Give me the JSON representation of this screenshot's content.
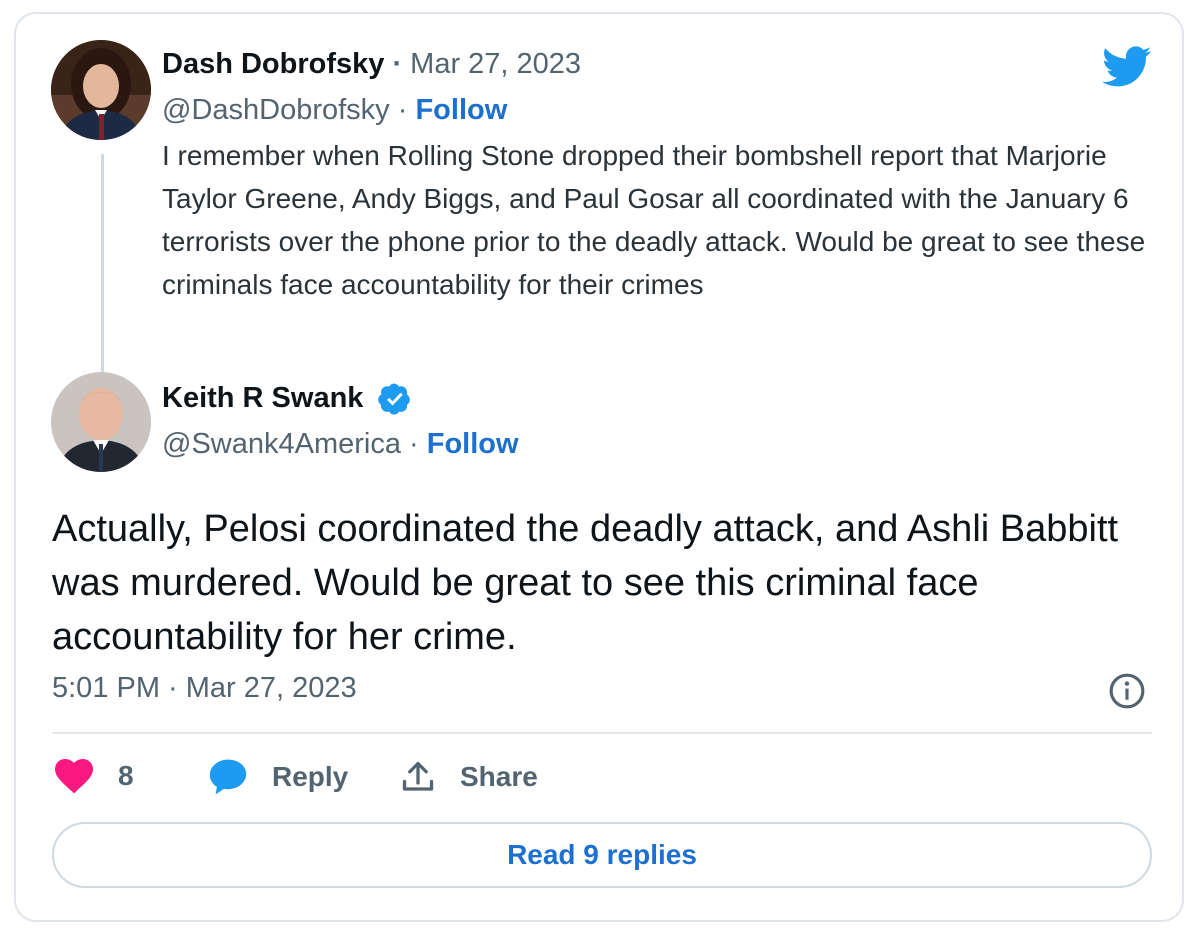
{
  "quoted_tweet": {
    "author_name": "Dash Dobrofsky",
    "date": "Mar 27, 2023",
    "handle": "@DashDobrofsky",
    "follow_label": "Follow",
    "text": "I remember when Rolling Stone dropped their bombshell report that Marjorie Taylor Greene, Andy Biggs, and Paul Gosar all coordinated with the January 6 terrorists over the phone prior to the deadly attack. Would be great to see these criminals face accountability for their crimes"
  },
  "main_tweet": {
    "author_name": "Keith R Swank",
    "verified": true,
    "handle": "@Swank4America",
    "follow_label": "Follow",
    "text": "Actually, Pelosi coordinated the deadly attack, and Ashli Babbitt was murdered. Would be great to see this criminal face accountability for her crime.",
    "timestamp": "5:01 PM · Mar 27, 2023"
  },
  "actions": {
    "like_count": "8",
    "reply_label": "Reply",
    "share_label": "Share"
  },
  "read_replies_label": "Read 9 replies",
  "separator": " · ",
  "icons": {
    "logo": "twitter-bird-icon",
    "info": "info-icon",
    "like": "heart-icon",
    "reply": "speech-bubble-icon",
    "share": "share-upload-icon",
    "verified": "verified-badge-icon"
  },
  "colors": {
    "brand_blue": "#1d9bf0",
    "link_blue": "#1d6fd0",
    "like_pink": "#f91880",
    "secondary_text": "#536471",
    "border": "#dfe5ea"
  }
}
